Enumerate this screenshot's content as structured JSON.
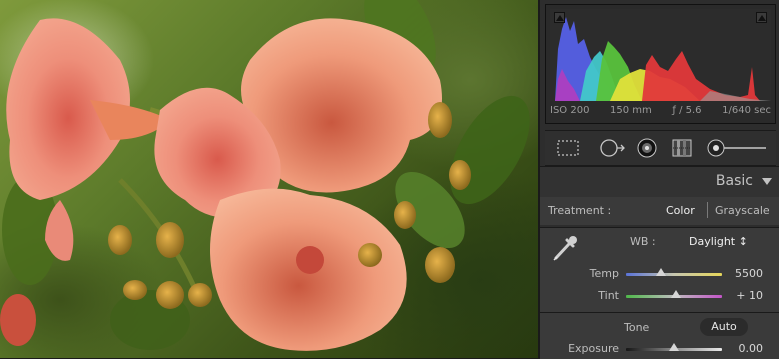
{
  "histogram": {
    "iso": "ISO 200",
    "focal_length": "150 mm",
    "aperture": "ƒ / 5.6",
    "shutter": "1/640 sec"
  },
  "tools": [
    "crop-overlay-tool",
    "spot-removal-tool",
    "red-eye-tool",
    "graduated-filter-tool",
    "adjustment-brush-tool"
  ],
  "basic_panel": {
    "title": "Basic",
    "treatment": {
      "label": "Treatment :",
      "color": "Color",
      "grayscale": "Grayscale",
      "selected": "Color"
    },
    "wb": {
      "label": "WB :",
      "value": "Daylight ↕"
    },
    "sliders": {
      "temp": {
        "label": "Temp",
        "value": "5500",
        "level": 0.36
      },
      "tint": {
        "label": "Tint",
        "value": "+ 10",
        "level": 0.52
      },
      "exposure": {
        "label": "Exposure",
        "value": "0.00",
        "level": 0.5
      }
    },
    "tone": {
      "label": "Tone",
      "auto": "Auto"
    }
  },
  "colors": {
    "panel_bg": "#3a3a3a",
    "histogram_blue": "#5560e6",
    "histogram_cyan": "#42c7c9",
    "histogram_green": "#58c23c",
    "histogram_yellow": "#e0e03a",
    "histogram_red": "#e2383a",
    "flower": "#e27a6a"
  }
}
